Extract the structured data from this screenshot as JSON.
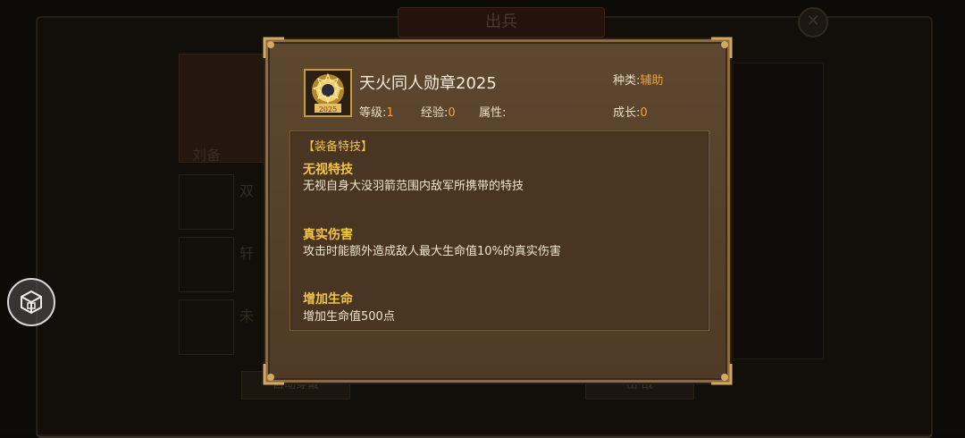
{
  "background": {
    "title": "出兵",
    "close_glyph": "✕",
    "hero_name": "刘备",
    "slot_labels": [
      "双",
      "轩",
      "未"
    ],
    "button_left": "自动穿戴",
    "button_right": "出 战"
  },
  "item": {
    "name": "天火同人勋章2025",
    "medal_text": "2025",
    "level_label": "等级:",
    "level_value": "1",
    "exp_label": "经验:",
    "exp_value": "0",
    "attr_label": "属性:",
    "kind_label": "种类:",
    "kind_value": "辅助",
    "growth_label": "成长:",
    "growth_value": "0"
  },
  "skills": {
    "section_title": "【装备特技】",
    "list": [
      {
        "name": "无视特技",
        "desc": "无视自身大没羽箭范围内敌军所携带的特技"
      },
      {
        "name": "真实伤害",
        "desc": "攻击时能额外造成敌人最大生命值10%的真实伤害"
      },
      {
        "name": "增加生命",
        "desc": "增加生命值500点"
      }
    ]
  },
  "icons": {
    "side": "treasure-box-icon",
    "medal": "medal-icon",
    "corner": "ornament-corner-icon"
  },
  "colors": {
    "accent_orange": "#f0a040",
    "skill_title_gold": "#f3c44a",
    "popup_border": "#8a6b43"
  }
}
